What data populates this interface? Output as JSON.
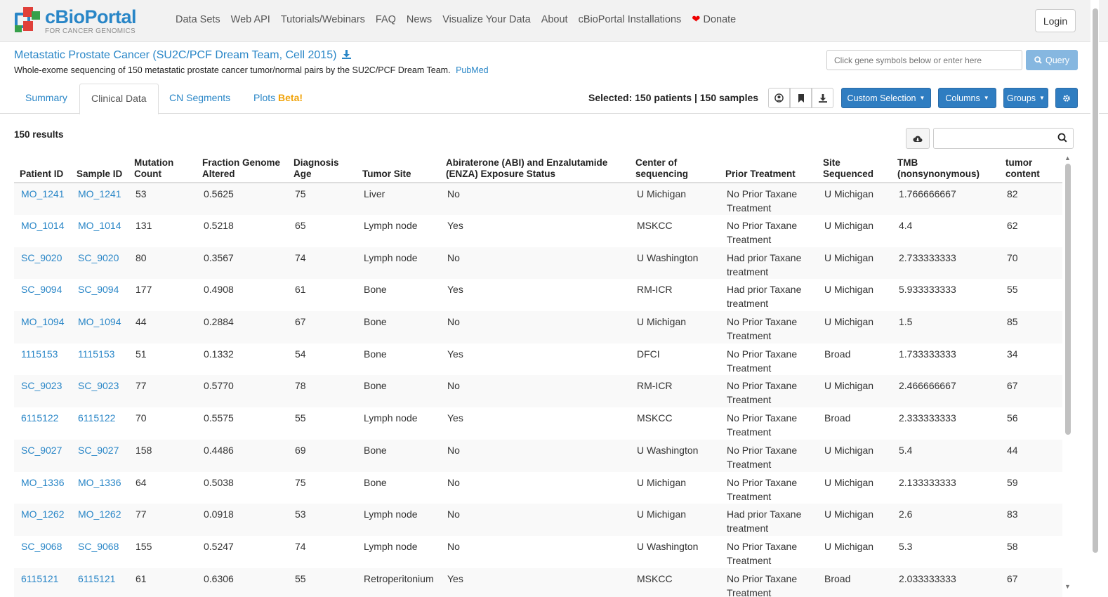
{
  "brand": {
    "title": "cBioPortal",
    "subtitle": "FOR CANCER GENOMICS"
  },
  "nav": {
    "items": [
      "Data Sets",
      "Web API",
      "Tutorials/Webinars",
      "FAQ",
      "News",
      "Visualize Your Data",
      "About",
      "cBioPortal Installations"
    ],
    "donate": "Donate",
    "login": "Login"
  },
  "study": {
    "title": "Metastatic Prostate Cancer (SU2C/PCF Dream Team, Cell 2015)",
    "description": "Whole-exome sequencing of 150 metastatic prostate cancer tumor/normal pairs by the SU2C/PCF Dream Team.",
    "pubmed": "PubMed"
  },
  "query": {
    "placeholder": "Click gene symbols below or enter here",
    "button": "Query"
  },
  "tabs": {
    "summary": "Summary",
    "clinical": "Clinical Data",
    "cn": "CN Segments",
    "plots": "Plots",
    "beta": "Beta!"
  },
  "toolbar": {
    "selected": "Selected: 150 patients | 150 samples",
    "custom_selection": "Custom Selection",
    "columns": "Columns",
    "groups": "Groups"
  },
  "results": {
    "count": "150 results"
  },
  "table": {
    "headers": [
      "Patient ID",
      "Sample ID",
      "Mutation Count",
      "Fraction Genome Altered",
      "Diagnosis Age",
      "Tumor Site",
      "Abiraterone (ABI) and Enzalutamide (ENZA) Exposure Status",
      "Center of sequencing",
      "Prior Treatment",
      "Site Sequenced",
      "TMB (nonsynonymous)",
      "tumor content"
    ],
    "rows": [
      [
        "MO_1241",
        "MO_1241",
        "53",
        "0.5625",
        "75",
        "Liver",
        "No",
        "U Michigan",
        "No Prior Taxane Treatment",
        "U Michigan",
        "1.766666667",
        "82"
      ],
      [
        "MO_1014",
        "MO_1014",
        "131",
        "0.5218",
        "65",
        "Lymph node",
        "Yes",
        "MSKCC",
        "No Prior Taxane Treatment",
        "U Michigan",
        "4.4",
        "62"
      ],
      [
        "SC_9020",
        "SC_9020",
        "80",
        "0.3567",
        "74",
        "Lymph node",
        "No",
        "U Washington",
        "Had prior Taxane treatment",
        "U Michigan",
        "2.733333333",
        "70"
      ],
      [
        "SC_9094",
        "SC_9094",
        "177",
        "0.4908",
        "61",
        "Bone",
        "Yes",
        "RM-ICR",
        "Had prior Taxane treatment",
        "U Michigan",
        "5.933333333",
        "55"
      ],
      [
        "MO_1094",
        "MO_1094",
        "44",
        "0.2884",
        "67",
        "Bone",
        "No",
        "U Michigan",
        "No Prior Taxane Treatment",
        "U Michigan",
        "1.5",
        "85"
      ],
      [
        "1115153",
        "1115153",
        "51",
        "0.1332",
        "54",
        "Bone",
        "Yes",
        "DFCI",
        "No Prior Taxane Treatment",
        "Broad",
        "1.733333333",
        "34"
      ],
      [
        "SC_9023",
        "SC_9023",
        "77",
        "0.5770",
        "78",
        "Bone",
        "No",
        "RM-ICR",
        "No Prior Taxane Treatment",
        "U Michigan",
        "2.466666667",
        "67"
      ],
      [
        "6115122",
        "6115122",
        "70",
        "0.5575",
        "55",
        "Lymph node",
        "Yes",
        "MSKCC",
        "No Prior Taxane Treatment",
        "Broad",
        "2.333333333",
        "56"
      ],
      [
        "SC_9027",
        "SC_9027",
        "158",
        "0.4486",
        "69",
        "Bone",
        "No",
        "U Washington",
        "No Prior Taxane Treatment",
        "U Michigan",
        "5.4",
        "44"
      ],
      [
        "MO_1336",
        "MO_1336",
        "64",
        "0.5038",
        "75",
        "Bone",
        "No",
        "U Michigan",
        "No Prior Taxane Treatment",
        "U Michigan",
        "2.133333333",
        "59"
      ],
      [
        "MO_1262",
        "MO_1262",
        "77",
        "0.0918",
        "53",
        "Lymph node",
        "No",
        "U Michigan",
        "Had prior Taxane treatment",
        "U Michigan",
        "2.6",
        "83"
      ],
      [
        "SC_9068",
        "SC_9068",
        "155",
        "0.5247",
        "74",
        "Lymph node",
        "No",
        "U Washington",
        "No Prior Taxane Treatment",
        "U Michigan",
        "5.3",
        "58"
      ],
      [
        "6115121",
        "6115121",
        "61",
        "0.6306",
        "55",
        "Retroperitonium",
        "Yes",
        "MSKCC",
        "No Prior Taxane Treatment",
        "Broad",
        "2.033333333",
        "67"
      ]
    ]
  },
  "colors": {
    "link": "#2986c7",
    "primary_button": "#2f7dc1",
    "beta": "#f0a30a",
    "heart": "#ee0000"
  },
  "icons": [
    "user-icon",
    "bookmark-icon",
    "download-icon",
    "gear-icon",
    "cloud-download-icon",
    "search-icon",
    "heart-icon"
  ]
}
